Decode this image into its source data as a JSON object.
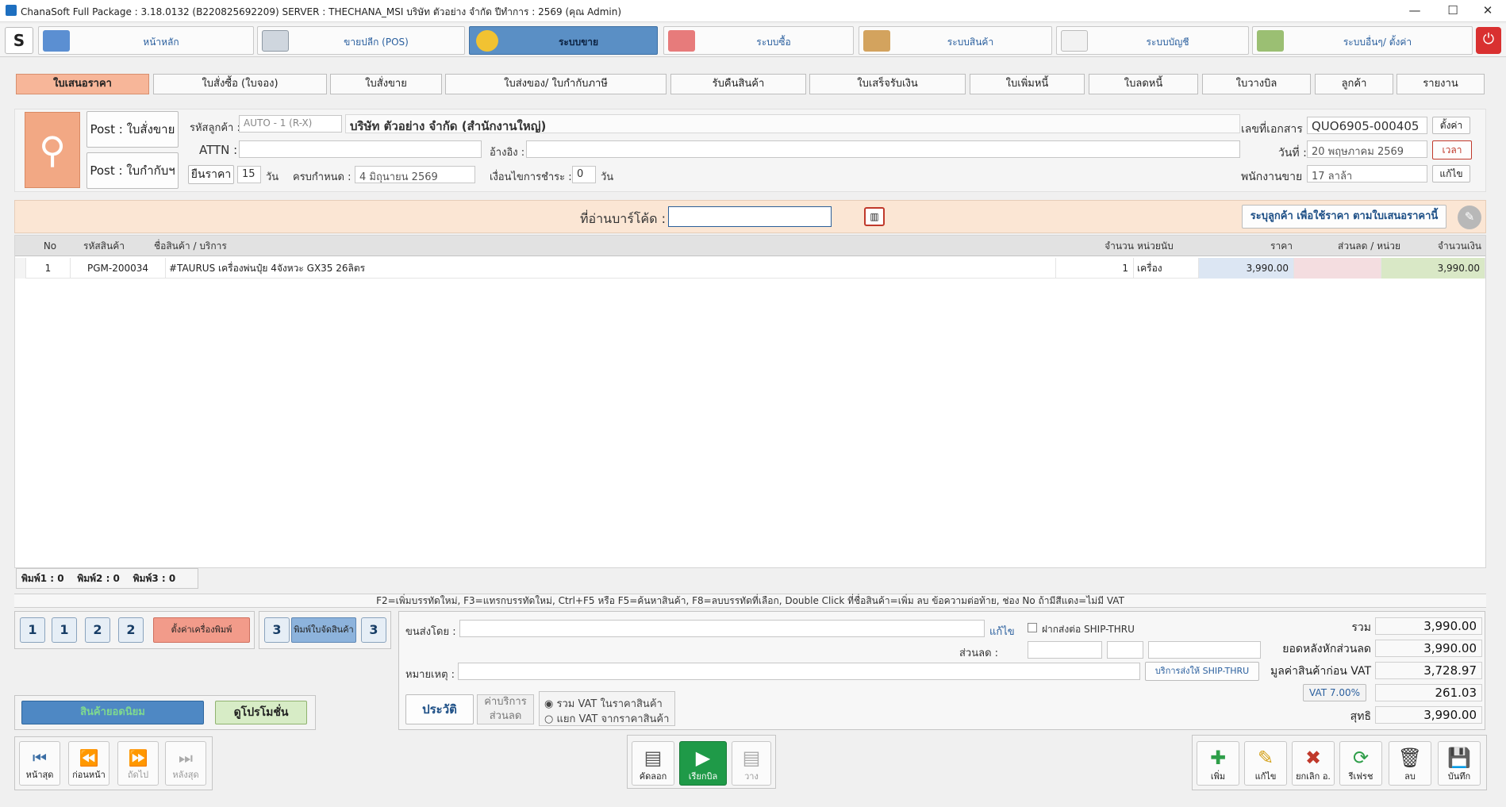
{
  "window": {
    "title": "ChanaSoft Full Package : 3.18.0132 (B220825692209) SERVER : THECHANA_MSI บริษัท ตัวอย่าง จำกัด ปีทำการ : 2569 (คุณ Admin)",
    "minimize": "—",
    "maximize": "☐",
    "close": "✕"
  },
  "modules": [
    {
      "label": "หน้าหลัก",
      "icon": "home-icon"
    },
    {
      "label": "ขายปลีก (POS)",
      "icon": "pos-terminal-icon"
    },
    {
      "label": "ระบบขาย",
      "icon": "coin-icon"
    },
    {
      "label": "ระบบซื้อ",
      "icon": "cart-icon"
    },
    {
      "label": "ระบบสินค้า",
      "icon": "box-icon"
    },
    {
      "label": "ระบบบัญชี",
      "icon": "report-icon"
    },
    {
      "label": "ระบบอื่นๆ/ ตั้งค่า",
      "icon": "gear-icon"
    }
  ],
  "tabs": [
    "ใบเสนอราคา",
    "ใบสั่งซื้อ (ใบจอง)",
    "ใบสั่งขาย",
    "ใบส่งของ/ ใบกำกับภาษี",
    "รับคืนสินค้า",
    "ใบเสร็จรับเงิน",
    "ใบเพิ่มหนี้",
    "ใบลดหนี้",
    "ใบวางบิล",
    "ลูกค้า",
    "รายงาน"
  ],
  "header": {
    "post_sales_order": "Post : ใบสั่งขาย",
    "post_tax_invoice": "Post : ใบกำกับฯ",
    "customer_code_label": "รหัสลูกค้า :",
    "customer_code_value": "AUTO - 1 (R-X)",
    "customer_name": "บริษัท ตัวอย่าง จำกัด (สำนักงานใหญ่)",
    "attn_label": "ATTN :",
    "attn_value": "",
    "ref_label": "อ้างอิง :",
    "ref_value": "",
    "confirm_price_label": "ยืนราคา",
    "confirm_price_days": "15",
    "day_unit": "วัน",
    "due_label": "ครบกำหนด :",
    "due_date": "4 มิถุนายน 2569",
    "payment_terms_label": "เงื่อนไขการชำระ :",
    "payment_terms_days": "0",
    "doc_no_label": "เลขที่เอกสาร :",
    "doc_no": "QUO6905-000405",
    "setup_button": "ตั้งค่า",
    "date_label": "วันที่ :",
    "date_value": "20 พฤษภาคม 2569",
    "time_button": "เวลา",
    "salesman_label": "พนักงานขาย :",
    "salesman_value": "17 ลาล้า",
    "edit_button": "แก้ไข"
  },
  "barcode": {
    "label": "ที่อ่านบาร์โค้ด :",
    "value": "",
    "customer_price_button": "ระบุลูกค้า เพื่อใช้ราคา ตามใบเสนอราคานี้"
  },
  "table": {
    "columns": {
      "no": "No",
      "code": "รหัสสินค้า",
      "name": "ชื่อสินค้า / บริการ",
      "qty": "จำนวน",
      "unit": "หน่วยนับ",
      "price": "ราคา",
      "discount": "ส่วนลด / หน่วย",
      "amount": "จำนวนเงิน"
    },
    "rows": [
      {
        "no": "1",
        "code": "PGM-200034",
        "name": "#TAURUS เครื่องพ่นปุ๋ย 4จังหวะ GX35 26ลิตร",
        "qty": "1",
        "unit": "เครื่อง",
        "price": "3,990.00",
        "discount": "",
        "amount": "3,990.00"
      }
    ]
  },
  "print_counts": {
    "p1": "พิมพ์1 : 0",
    "p2": "พิมพ์2 : 0",
    "p3": "พิมพ์3 : 0"
  },
  "help_text": "F2=เพิ่มบรรทัดใหม่,  F3=แทรกบรรทัดใหม่,  Ctrl+F5 หรือ F5=ค้นหาสินค้า,  F8=ลบบรรทัดที่เลือก,  Double Click ที่ชื่อสินค้า=เพิ่ม ลบ ข้อความต่อท้าย,  ช่อง No ถ้ามีสีแดง=ไม่มี VAT",
  "print_tools": {
    "setup_printer": "ตั้งค่าเครื่องพิมพ์",
    "print_picking": "พิมพ์ใบจัดสินค้า",
    "t1": "1",
    "t1i": "1",
    "t2": "2",
    "t2i": "2",
    "t3": "3",
    "t3i": "3"
  },
  "promo": {
    "popular": "สินค้ายอดนิยม",
    "promotion": "ดูโปรโมชั่น"
  },
  "shipping": {
    "ship_by_label": "ขนส่งโดย :",
    "ship_by_value": "",
    "edit": "แก้ไข",
    "ship_thru_checkbox": "ฝากส่งต่อ SHIP-THRU",
    "discount_label": "ส่วนลด :",
    "note_label": "หมายเหตุ :",
    "note_value": "",
    "ship_thru_service": "บริการส่งให้ SHIP-THRU"
  },
  "history_button": "ประวัติ",
  "service_discount": {
    "line1": "ค่าบริการ",
    "line2": "ส่วนลด"
  },
  "vat_options": {
    "inclusive": "รวม VAT ในราคาสินค้า",
    "exclusive": "แยก VAT จากราคาสินค้า"
  },
  "totals": {
    "total_label": "รวม",
    "total": "3,990.00",
    "after_discount_label": "ยอดหลังหักส่วนลด",
    "after_discount": "3,990.00",
    "before_vat_label": "มูลค่าสินค้าก่อน VAT",
    "before_vat": "3,728.97",
    "vat_label": "VAT 7.00%",
    "vat": "261.03",
    "net_label": "สุทธิ",
    "net": "3,990.00"
  },
  "nav": {
    "first": "หน้าสุด",
    "prev": "ก่อนหน้า",
    "next": "ถัดไป",
    "last": "หลังสุด"
  },
  "middle_actions": {
    "copy": "คัดลอก",
    "call_bill": "เรียกบิล",
    "paste": "วาง"
  },
  "actions": {
    "add": "เพิ่ม",
    "edit": "แก้ไข",
    "cancel": "ยกเลิก อ.",
    "refresh": "รีเฟรช",
    "delete": "ลบ",
    "save": "บันทึก"
  },
  "colors": {
    "active_module": "#5a8fc5",
    "active_tab": "#f7b699",
    "barcode_strip": "#fbe6d4",
    "price_cell": "#dce6f3",
    "discount_cell": "#f4dde0",
    "amount_cell": "#d9e8c6"
  }
}
